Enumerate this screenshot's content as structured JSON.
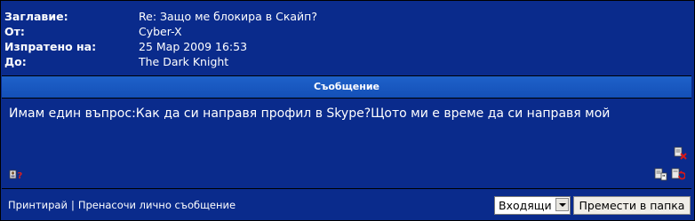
{
  "header": {
    "rows": [
      {
        "label": "Заглавие:",
        "value": "Re: Защо ме блокира в Скайп?"
      },
      {
        "label": "От:",
        "value": "Cyber-X"
      },
      {
        "label": "Изпратено на:",
        "value": "25 Мар 2009 16:53"
      },
      {
        "label": "До:",
        "value": "The Dark Knight"
      }
    ]
  },
  "message": {
    "heading": "Съобщение",
    "text": "Имам един въпрос:Как да си направя профил в Skype?Щото ми е време да си направя мой"
  },
  "footer": {
    "print_label": "Принтирай",
    "separator": "|",
    "forward_label": "Пренасочи лично съобщение",
    "folder_select_value": "Входящи",
    "move_button_label": "Премести в папка"
  },
  "icons": [
    "user-info-icon",
    "delete-icon",
    "quote-icon",
    "reply-icon"
  ]
}
